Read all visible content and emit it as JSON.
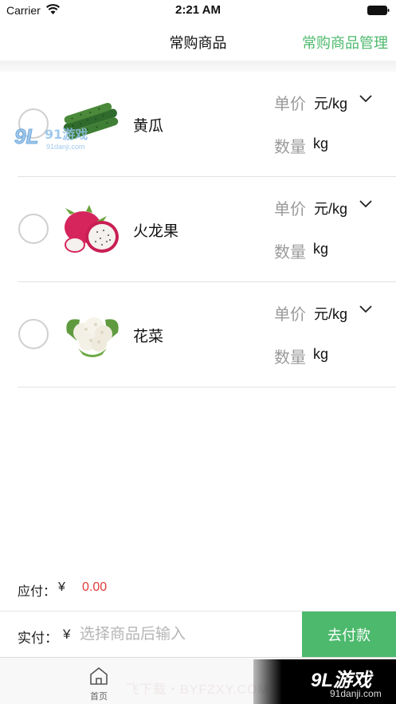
{
  "status_bar": {
    "carrier": "Carrier",
    "time": "2:21 AM",
    "wifi_icon": "wifi-icon",
    "battery_icon": "battery-icon"
  },
  "nav": {
    "title": "常购商品",
    "manage": "常购商品管理"
  },
  "products": [
    {
      "name": "黄瓜",
      "price_label": "单价",
      "price_unit": "元/kg",
      "qty_label": "数量",
      "qty_unit": "kg",
      "image": "cucumber",
      "selected": false
    },
    {
      "name": "火龙果",
      "price_label": "单价",
      "price_unit": "元/kg",
      "qty_label": "数量",
      "qty_unit": "kg",
      "image": "dragon-fruit",
      "selected": false
    },
    {
      "name": "花菜",
      "price_label": "单价",
      "price_unit": "元/kg",
      "qty_label": "数量",
      "qty_unit": "kg",
      "image": "cauliflower",
      "selected": false
    }
  ],
  "totals": {
    "due_label": "应付：",
    "due_currency": "¥",
    "due_amount": "0.00",
    "pay_label": "实付：",
    "pay_currency": "¥",
    "pay_placeholder": "选择商品后输入",
    "pay_button": "去付款"
  },
  "tab_bar": {
    "home_label": "首页",
    "home_icon": "home-icon"
  },
  "watermarks": {
    "top_logo_brand": "91游戏",
    "top_logo_url": "91danji.com",
    "bottom_text": "飞下载・BYFZXY.COM",
    "badge_brand": "9L游戏",
    "badge_url": "91danji.com"
  },
  "colors": {
    "accent_green": "#4cb96c",
    "amount_red": "#e03a3a",
    "label_gray": "#9a9a9a"
  }
}
